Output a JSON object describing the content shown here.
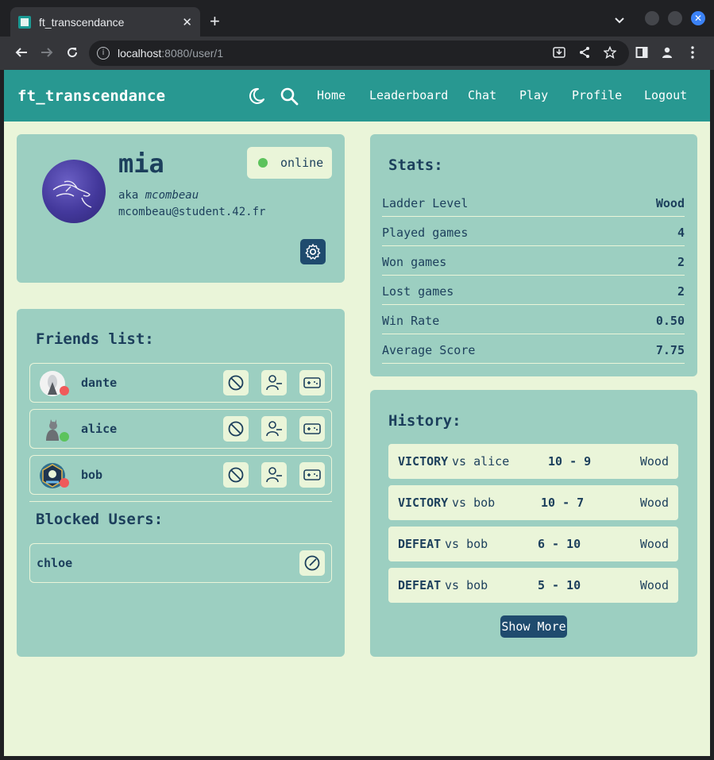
{
  "browser": {
    "tab_title": "ft_transcendance",
    "url_host": "localhost",
    "url_rest": ":8080/user/1"
  },
  "nav": {
    "brand": "ft_transcendance",
    "links": [
      "Home",
      "Leaderboard",
      "Chat",
      "Play",
      "Profile",
      "Logout"
    ]
  },
  "profile": {
    "username": "mia",
    "aka_prefix": "aka",
    "login": "mcombeau",
    "email": "mcombeau@student.42.fr",
    "status": "online",
    "status_color": "#5cc35c"
  },
  "friends": {
    "title": "Friends list:",
    "items": [
      {
        "name": "dante",
        "status_color": "#f05a5a"
      },
      {
        "name": "alice",
        "status_color": "#5cc35c"
      },
      {
        "name": "bob",
        "status_color": "#f05a5a"
      }
    ]
  },
  "blocked": {
    "title": "Blocked Users:",
    "items": [
      {
        "name": "chloe"
      }
    ]
  },
  "stats": {
    "title": "Stats:",
    "rows": [
      {
        "label": "Ladder Level",
        "value": "Wood"
      },
      {
        "label": "Played games",
        "value": "4"
      },
      {
        "label": "Won games",
        "value": "2"
      },
      {
        "label": "Lost games",
        "value": "2"
      },
      {
        "label": "Win Rate",
        "value": "0.50"
      },
      {
        "label": "Average Score",
        "value": "7.75"
      }
    ]
  },
  "history": {
    "title": "History:",
    "rows": [
      {
        "result": "VICTORY",
        "opponent": "vs alice",
        "score": "10 - 9",
        "level": "Wood"
      },
      {
        "result": "VICTORY",
        "opponent": "vs bob",
        "score": "10 - 7",
        "level": "Wood"
      },
      {
        "result": "DEFEAT",
        "opponent": "vs bob",
        "score": "6 - 10",
        "level": "Wood"
      },
      {
        "result": "DEFEAT",
        "opponent": "vs bob",
        "score": "5 - 10",
        "level": "Wood"
      }
    ],
    "show_more": "Show More"
  },
  "colors": {
    "page_bg": "#eaf5d9",
    "navbar": "#289891",
    "card": "#9ccfc1",
    "text_dark": "#1c3f5c",
    "button_dark": "#1f4b6e"
  }
}
